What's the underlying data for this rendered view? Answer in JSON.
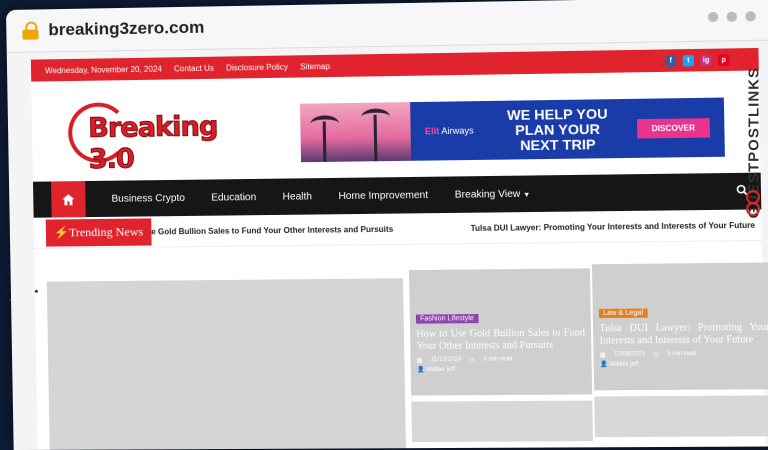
{
  "browser": {
    "url": "breaking3zero.com"
  },
  "topbar": {
    "date": "Wednesday, November 20, 2024",
    "links": [
      "Contact Us",
      "Disclosure Policy",
      "Sitemap"
    ],
    "social": [
      "f",
      "t",
      "ig",
      "p"
    ],
    "social_colors": [
      "#3b5998",
      "#1da1f2",
      "#c13584",
      "#e60023"
    ]
  },
  "logo": {
    "text": "Breaking 3.0"
  },
  "ad": {
    "brand_prefix": "Elit",
    "brand_suffix": " Airways",
    "headline": "WE HELP YOU PLAN YOUR NEXT TRIP",
    "cta": "DISCOVER"
  },
  "nav": {
    "items": [
      "Business Crypto",
      "Education",
      "Health",
      "Home Improvement",
      "Breaking View"
    ]
  },
  "trending": {
    "label": "Trending News",
    "items": [
      "e Gold Bullion Sales to Fund Your Other Interests and Pursuits",
      "Tulsa DUI Lawyer: Promoting Your Interests and Interests of Your Future"
    ]
  },
  "posts": [
    {
      "category": "Fashion Lifestyle",
      "category_color": "#8e44ad",
      "title": "How to Use Gold Bullion Sales to Fund Your Other Interests and Pursuits",
      "date": "15/10/2024",
      "read": "3 min read",
      "author": "Walker jeff"
    },
    {
      "category": "Law & Legal",
      "category_color": "#e67e22",
      "title": "Tulsa DUI Lawyer: Promoting Your Interests and Interests of Your Future",
      "date": "17/08/2024",
      "read": "3 min read",
      "author": "Walker jeff"
    }
  ],
  "watermark": "GUESTPOSTLINKS"
}
